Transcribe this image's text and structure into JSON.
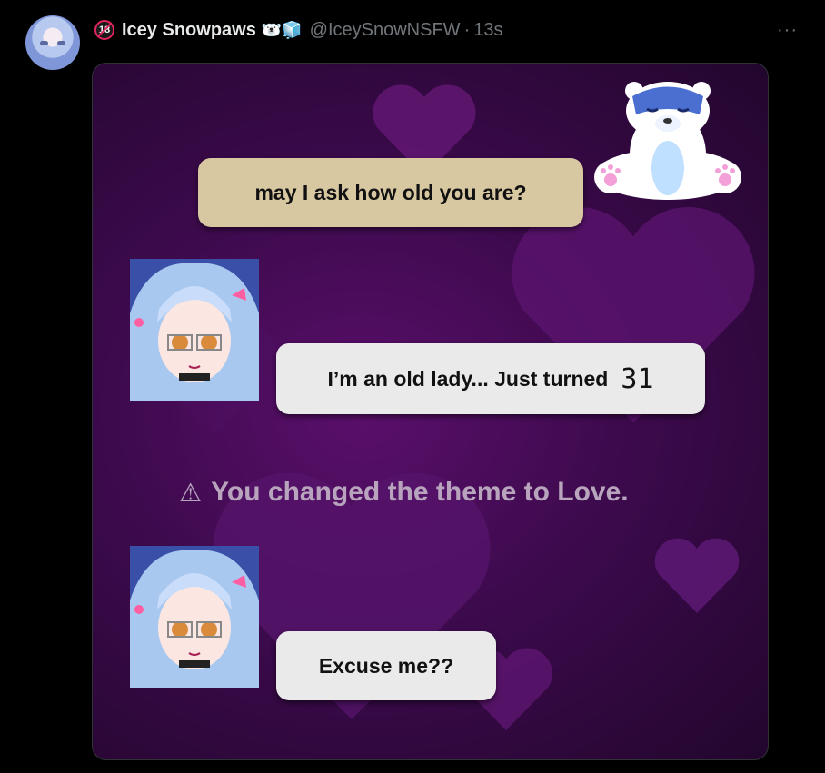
{
  "post": {
    "age_badge": "18",
    "display_name": "Icey Snowpaws",
    "name_emojis": "🐻‍❄️🧊",
    "handle": "@IceySnowNSFW",
    "separator": "·",
    "time": "13s",
    "more_label": "···"
  },
  "image": {
    "message_1": "may I ask how old you are?",
    "message_2": "I’m an old lady... Just turned",
    "message_2_number": "31",
    "notice": "You changed the theme to Love.",
    "notice_icon": "⚠",
    "message_3": "Excuse me??"
  },
  "colors": {
    "background": "#000000",
    "media_bg": "#3d0a4d",
    "bubble_tan": "#d8c8a2",
    "bubble_grey": "#eaeaea",
    "handle_grey": "#71767b"
  }
}
